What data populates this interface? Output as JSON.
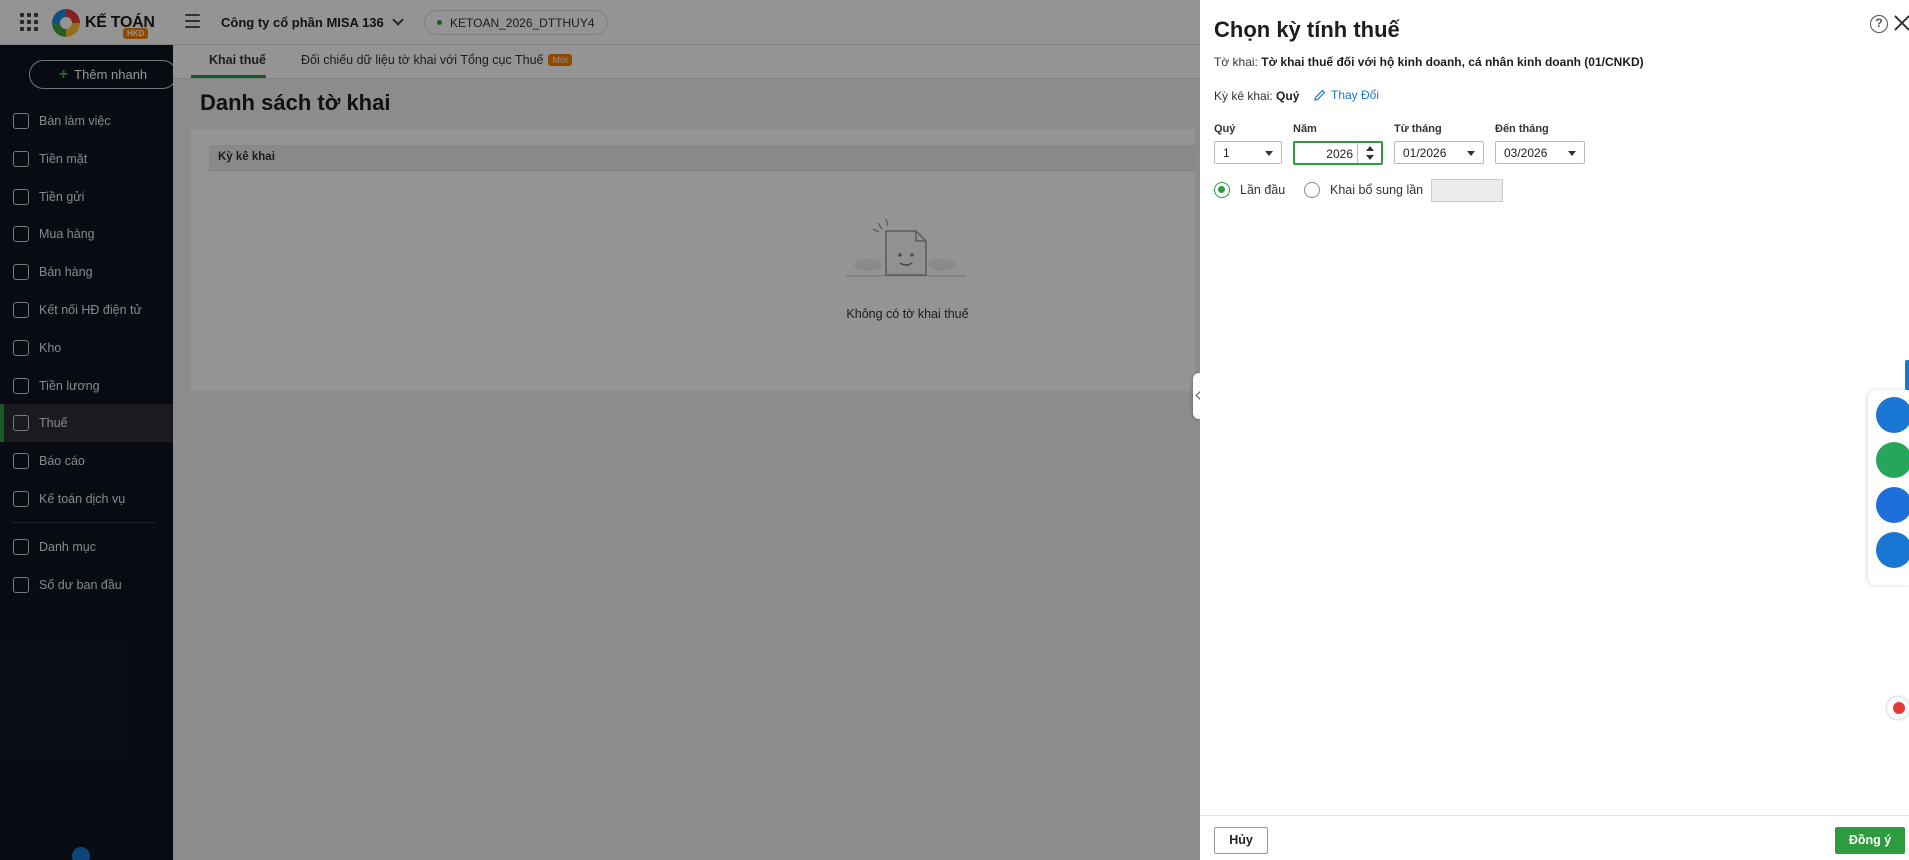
{
  "header": {
    "logo_text": "KẾ TOÁN",
    "logo_badge": "HKD",
    "company": "Công ty cổ phần MISA 136",
    "database": "KETOAN_2026_DTTHUY4"
  },
  "sidebar": {
    "quick_add": "Thêm nhanh",
    "items": [
      {
        "label": "Bàn làm việc",
        "icon": "dashboard-icon"
      },
      {
        "label": "Tiền mặt",
        "icon": "cash-bag-icon"
      },
      {
        "label": "Tiền gửi",
        "icon": "bank-icon"
      },
      {
        "label": "Mua hàng",
        "icon": "shopping-bag-icon"
      },
      {
        "label": "Bán hàng",
        "icon": "cart-icon"
      },
      {
        "label": "Kết nối HĐ điện tử",
        "icon": "invoice-icon"
      },
      {
        "label": "Kho",
        "icon": "warehouse-icon"
      },
      {
        "label": "Tiền lương",
        "icon": "salary-icon"
      },
      {
        "label": "Thuế",
        "icon": "tax-icon"
      },
      {
        "label": "Báo cáo",
        "icon": "report-chart-icon"
      },
      {
        "label": "Kế toán dịch vụ",
        "icon": "service-icon"
      },
      {
        "label": "Danh mục",
        "icon": "list-icon"
      },
      {
        "label": "Số dư ban đầu",
        "icon": "opening-balance-icon"
      }
    ],
    "active_index": 8
  },
  "main": {
    "tabs": [
      {
        "label": "Khai thuế"
      },
      {
        "label": "Đối chiếu dữ liệu tờ khai với Tổng cục Thuế",
        "badge": "Mới"
      }
    ],
    "page_title": "Danh sách tờ khai",
    "table_header": "Kỳ kê khai",
    "empty_text": "Không có tờ khai thuế"
  },
  "drawer": {
    "title": "Chọn kỳ tính thuế",
    "declaration_label": "Tờ khai:",
    "declaration_value": "Tờ khai thuế đối với hộ kinh doanh, cá nhân kinh doanh (01/CNKD)",
    "period_label": "Kỳ kê khai:",
    "period_value": "Quý",
    "change_link": "Thay Đổi",
    "fields": {
      "quarter": {
        "label": "Quý",
        "value": "1"
      },
      "year": {
        "label": "Năm",
        "value": "2026"
      },
      "from_month": {
        "label": "Từ tháng",
        "value": "01/2026"
      },
      "to_month": {
        "label": "Đến tháng",
        "value": "03/2026"
      }
    },
    "radio_first": "Lần đầu",
    "radio_supplement": "Khai bổ sung lần",
    "cancel": "Hủy",
    "ok": "Đồng ý"
  },
  "colors": {
    "accent_green": "#2e9b3e",
    "sidebar_bg": "#0f1420",
    "link_blue": "#1976d2",
    "badge_orange": "#f57c00"
  }
}
